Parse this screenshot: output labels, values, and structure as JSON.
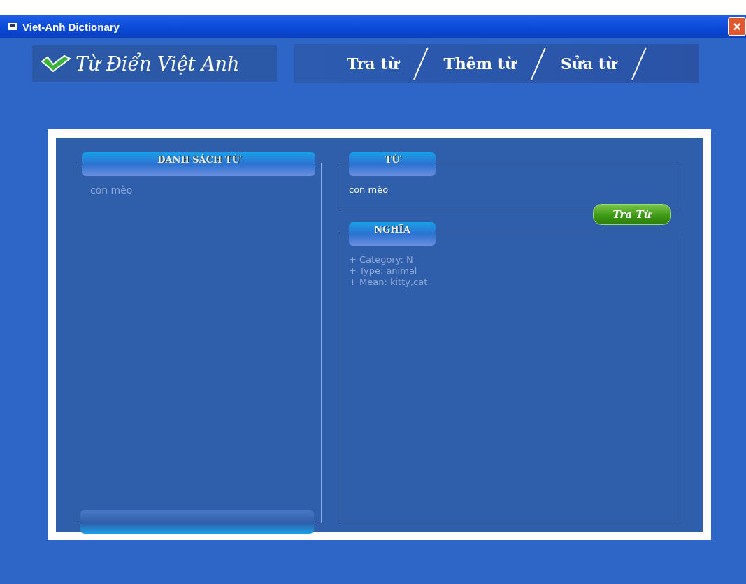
{
  "window": {
    "title": "Viet-Anh Dictionary",
    "close": "×"
  },
  "logo": {
    "text": "Từ Điển Việt Anh"
  },
  "tabs": [
    {
      "label": "Tra từ"
    },
    {
      "label": "Thêm từ"
    },
    {
      "label": "Sửa từ"
    }
  ],
  "word_list": {
    "heading": "DANH SÁCH TỪ",
    "items": [
      "con mèo"
    ]
  },
  "word": {
    "heading": "TỪ",
    "value": "con mèo",
    "button": "Tra Từ"
  },
  "meaning": {
    "heading": "NGHĨA",
    "lines": [
      "+ Category: N",
      "+ Type: animal",
      "+ Mean: kitty,cat"
    ]
  }
}
